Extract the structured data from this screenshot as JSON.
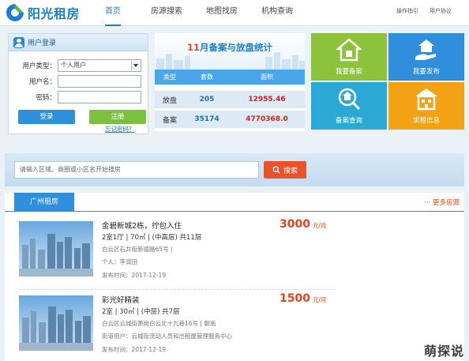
{
  "header": {
    "logo_text": "阳光租房",
    "nav": [
      "首页",
      "房源搜索",
      "地图找房",
      "机构查询"
    ],
    "top_links": [
      "操作指引",
      "用户协议"
    ]
  },
  "login": {
    "title": "用户登录",
    "type_label": "用户类型：",
    "type_value": "个人用户",
    "user_label": "用户名：",
    "pass_label": "密码：",
    "login_btn": "登录",
    "register_btn": "注册",
    "forgot": "忘记密码？"
  },
  "stats": {
    "title_num": "11",
    "title_rest": "月备案与放盘统计",
    "headers": [
      "类型",
      "套数",
      "面积"
    ],
    "rows": [
      {
        "type": "放盘",
        "count": "205",
        "area": "12955.46"
      },
      {
        "type": "备案",
        "count": "35174",
        "area": "4770368.0"
      }
    ]
  },
  "tiles": [
    "我要备案",
    "我要发布",
    "备案查询",
    "求租信息"
  ],
  "search": {
    "placeholder": "请输入区域、商圈或小区名开始搜房",
    "button": "搜索"
  },
  "listing": {
    "tab": "广州租房",
    "more": "··· 更多房源",
    "items": [
      {
        "title": "金碧新城2栋，拧包入住",
        "spec": "2室1厅 | 70㎡ | (中高层) 共11层",
        "addr": "白云区石井街新德路65号 |",
        "person": "个人：李润田",
        "date": "发布时间：2017-12-19",
        "price": "3000",
        "unit": "元/月"
      },
      {
        "title": "彩光好精装",
        "spec": "2室 | 30㎡ | (中层) 共7层",
        "addr": "白云区云城街萧岗白云北十九巷16号 | 朝南",
        "person": "街道用户：云城街流动人员和出租屋管理服务中心",
        "date": "发布时间：2017-12-19",
        "price": "1500",
        "unit": "元/月"
      }
    ]
  },
  "watermark": "萌探说"
}
